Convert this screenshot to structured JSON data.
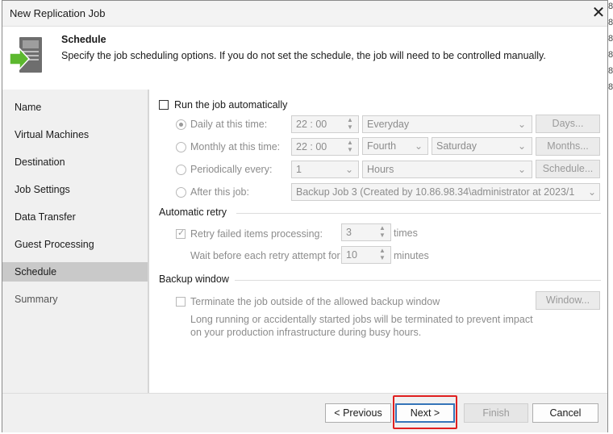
{
  "window": {
    "title": "New Replication Job"
  },
  "header": {
    "title": "Schedule",
    "description": "Specify the job scheduling options. If you do not set the schedule, the job will need to be controlled manually."
  },
  "nav": {
    "items": [
      {
        "label": "Name"
      },
      {
        "label": "Virtual Machines"
      },
      {
        "label": "Destination"
      },
      {
        "label": "Job Settings"
      },
      {
        "label": "Data Transfer"
      },
      {
        "label": "Guest Processing"
      },
      {
        "label": "Schedule"
      },
      {
        "label": "Summary"
      }
    ]
  },
  "schedule": {
    "run_auto_label": "Run the job automatically",
    "run_auto_checked": false,
    "daily": {
      "label": "Daily at this time:",
      "time": "22 : 00",
      "option": "Everyday",
      "button": "Days..."
    },
    "monthly": {
      "label": "Monthly at this time:",
      "time": "22 : 00",
      "week": "Fourth",
      "day": "Saturday",
      "button": "Months..."
    },
    "periodic": {
      "label": "Periodically every:",
      "value": "1",
      "unit": "Hours",
      "button": "Schedule..."
    },
    "after": {
      "label": "After this job:",
      "value": "Backup Job 3 (Created by 10.86.98.34\\administrator at 2023/1"
    }
  },
  "retry": {
    "section": "Automatic retry",
    "label": "Retry failed items processing:",
    "count": "3",
    "count_unit": "times",
    "wait_label": "Wait before each retry attempt for:",
    "wait": "10",
    "wait_unit": "minutes"
  },
  "backup_window": {
    "section": "Backup window",
    "label": "Terminate the job outside of the allowed backup window",
    "note_line1": "Long running or accidentally started jobs will be terminated to prevent impact",
    "note_line2": "on your production infrastructure during busy hours.",
    "button": "Window..."
  },
  "footer": {
    "previous": "< Previous",
    "next": "Next >",
    "finish": "Finish",
    "cancel": "Cancel"
  },
  "background": {
    "fragments": [
      "8",
      "8",
      "8",
      "8",
      "8",
      "8"
    ]
  },
  "colors": {
    "accent": "#3574b8",
    "highlight": "#e02020",
    "selected_nav": "#c9c9c9",
    "icon_green": "#5cb82e"
  }
}
